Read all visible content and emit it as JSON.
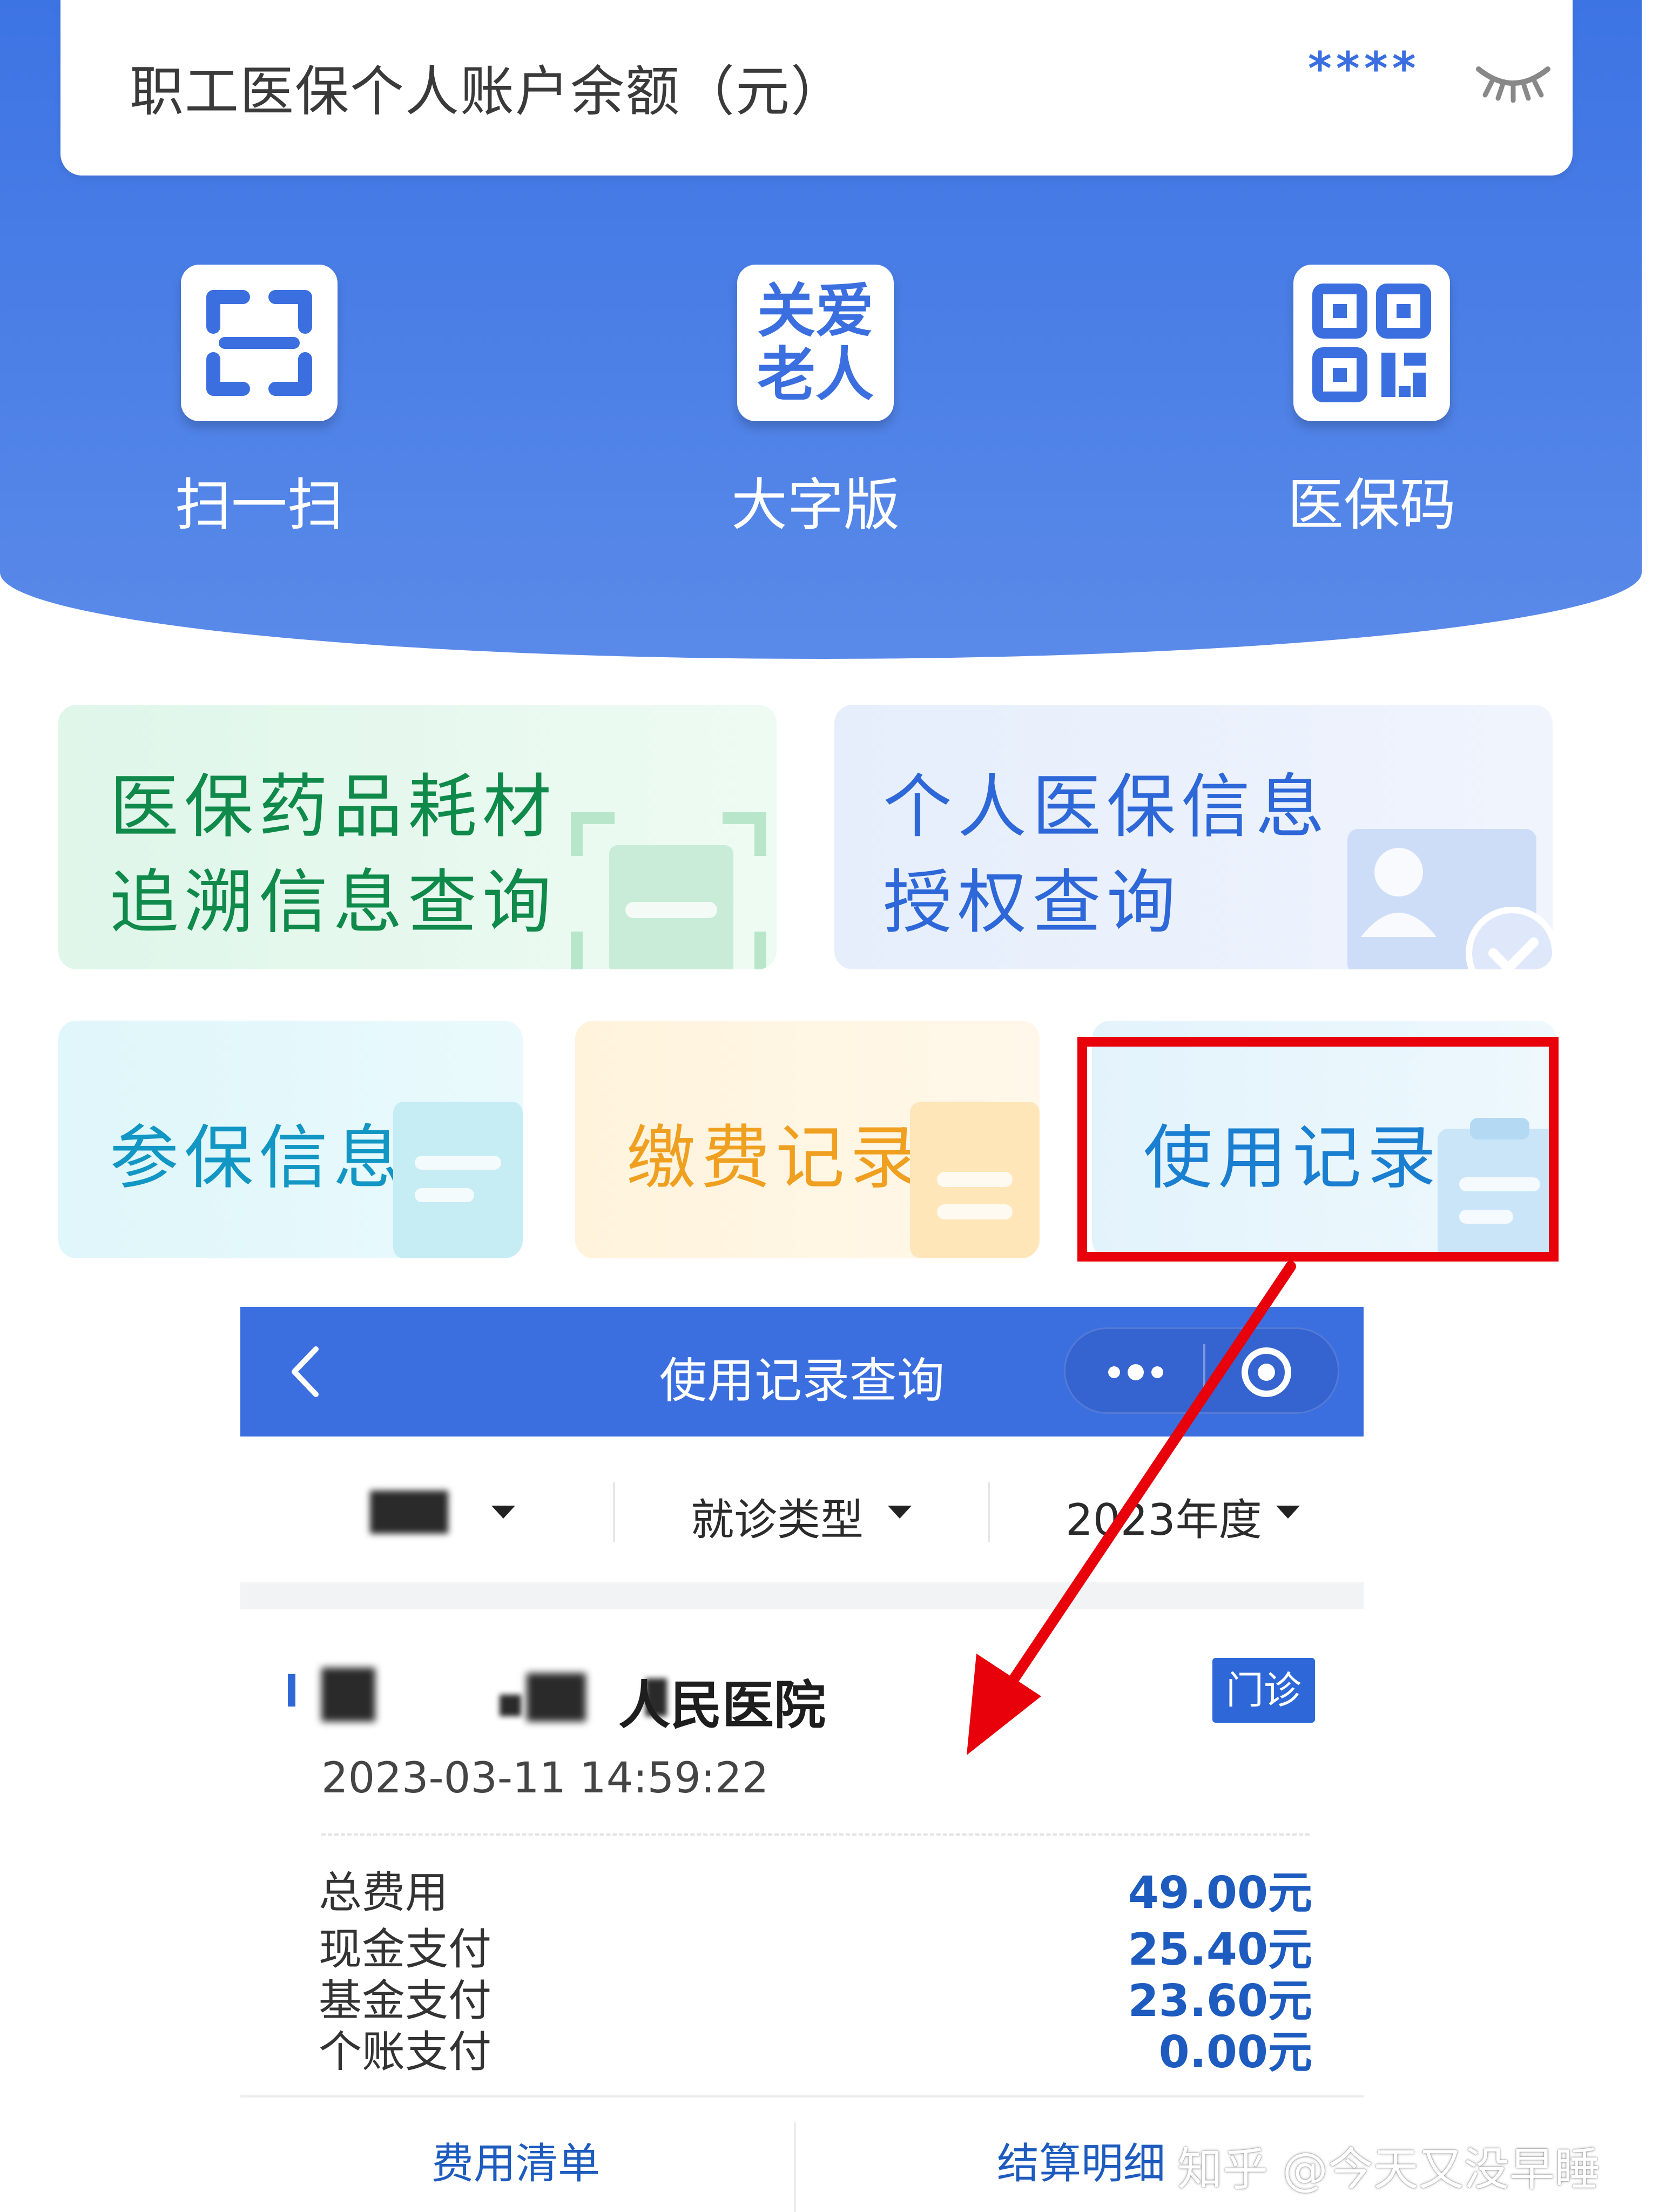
{
  "account": {
    "balance_label": "职工医保个人账户余额（元）",
    "balance_masked": "****",
    "toggle_icon": "eye-closed-icon"
  },
  "quick_actions": [
    {
      "label": "扫一扫",
      "icon": "scan-icon"
    },
    {
      "label": "大字版",
      "icon": "elder-care-icon",
      "icon_text_line1": "关爱",
      "icon_text_line2": "老人"
    },
    {
      "label": "医保码",
      "icon": "qr-code-icon"
    }
  ],
  "services": {
    "drug_trace": {
      "line1": "医保药品耗材",
      "line2": "追溯信息查询"
    },
    "personal_auth": {
      "line1": "个人医保信息",
      "line2": "授权查询"
    },
    "enrollment": {
      "label": "参保信息"
    },
    "payment_records": {
      "label": "缴费记录"
    },
    "usage_records": {
      "label": "使用记录"
    }
  },
  "record_screen": {
    "title": "使用记录查询",
    "back_icon": "chevron-left-icon",
    "more_icon": "more-dots-icon",
    "close_icon": "target-icon",
    "filters": [
      {
        "label": "",
        "icon": "caret-down-icon"
      },
      {
        "label": "就诊类型",
        "icon": "caret-down-icon"
      },
      {
        "label": "2023年度",
        "icon": "caret-down-icon"
      }
    ],
    "record": {
      "hospital_suffix": "人民医院",
      "visit_type": "门诊",
      "datetime": "2023-03-11 14:59:22",
      "fees": [
        {
          "label": "总费用",
          "value": "49.00元"
        },
        {
          "label": "现金支付",
          "value": "25.40元"
        },
        {
          "label": "基金支付",
          "value": "23.60元"
        },
        {
          "label": "个账支付",
          "value": "0.00元"
        }
      ]
    },
    "bottom_tabs": [
      "费用清单",
      "结算明细"
    ]
  },
  "watermark": "知乎 @今天又没早睡",
  "colors": {
    "header_blue": "#3d74e4",
    "highlight_red": "#e8000b",
    "value_blue": "#1d5bbf",
    "green_text": "#0f8a4a",
    "orange_text": "#f0a020"
  }
}
